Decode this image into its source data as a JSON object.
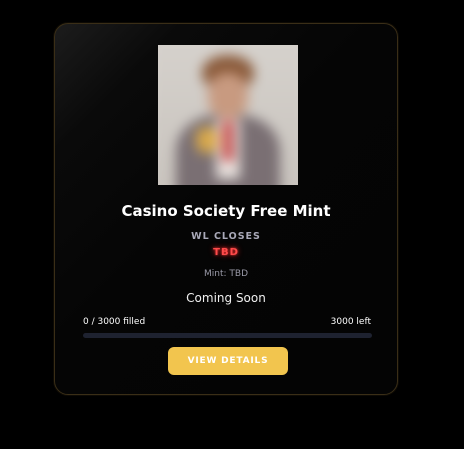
{
  "card": {
    "title": "Casino Society Free Mint",
    "wl_label": "WL CLOSES",
    "wl_value": "TBD",
    "mint_label": "Mint: TBD",
    "status": "Coming Soon",
    "filled_text": "0 / 3000 filled",
    "left_text": "3000 left",
    "progress_fraction": 0,
    "button_label": "VIEW DETAILS"
  },
  "colors": {
    "accent": "#f2c54e",
    "wl_value": "#ff4b4b",
    "border": "#3a2e17",
    "track": "#1e2230"
  },
  "icons": [
    "nft-thumbnail"
  ]
}
